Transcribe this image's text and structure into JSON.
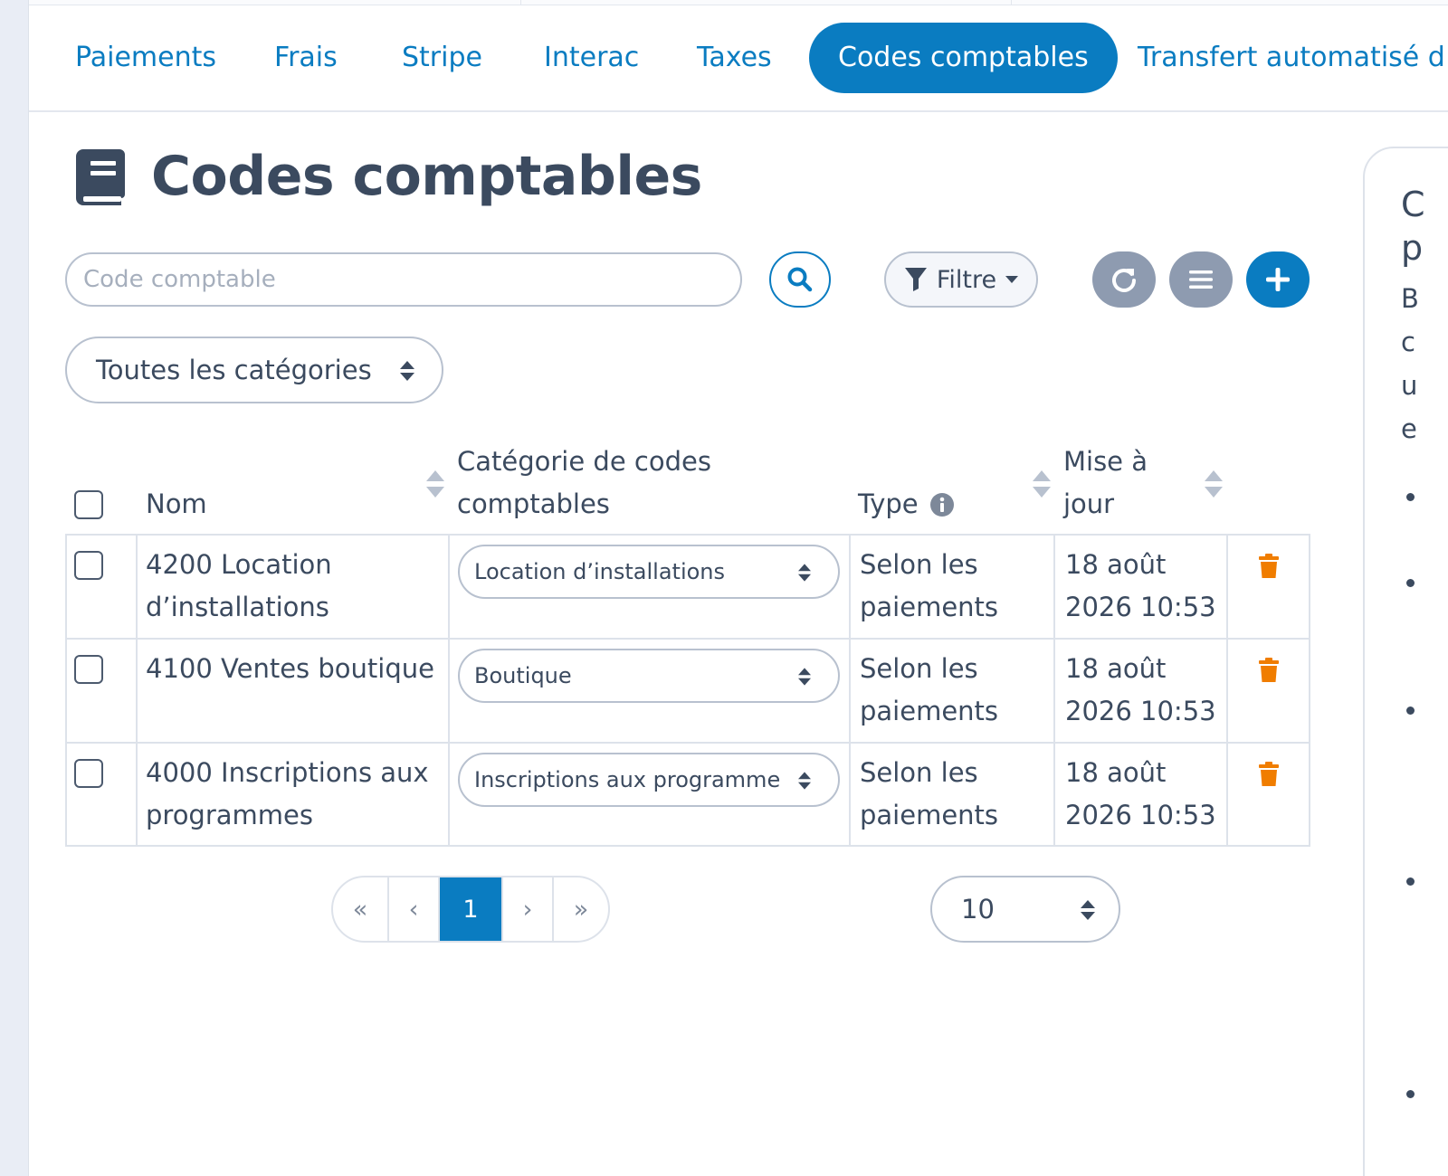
{
  "tabs": [
    {
      "label": "Paiements"
    },
    {
      "label": "Frais"
    },
    {
      "label": "Stripe"
    },
    {
      "label": "Interac"
    },
    {
      "label": "Taxes"
    },
    {
      "label": "Codes comptables"
    },
    {
      "label": "Transfert automatisé d"
    }
  ],
  "active_tab": "Codes comptables",
  "page": {
    "title": "Codes comptables",
    "title_icon": "book-icon"
  },
  "toolbar": {
    "search_placeholder": "Code comptable",
    "search_icon": "search-icon",
    "filter_label": "Filtre",
    "refresh_icon": "refresh-icon",
    "list_icon": "list-icon",
    "add_icon": "plus-icon"
  },
  "category_filter": {
    "selected": "Toutes les catégories"
  },
  "table": {
    "columns": {
      "name": "Nom",
      "category_line1": "Catégorie de codes",
      "category_line2": "comptables",
      "type": "Type",
      "updated_line1": "Mise à",
      "updated_line2": "jour"
    },
    "rows": [
      {
        "name_line1": "4200 Location",
        "name_line2": "d’installations",
        "category": "Location d’installations",
        "type_line1": "Selon les",
        "type_line2": "paiements",
        "updated_line1": "18 août",
        "updated_line2": "2026 10:53"
      },
      {
        "name_line1": "4100 Ventes boutique",
        "name_line2": "",
        "category": "Boutique",
        "type_line1": "Selon les",
        "type_line2": "paiements",
        "updated_line1": "18 août",
        "updated_line2": "2026 10:53"
      },
      {
        "name_line1": "4000 Inscriptions aux",
        "name_line2": "programmes",
        "category": "Inscriptions aux programme",
        "type_line1": "Selon les",
        "type_line2": "paiements",
        "updated_line1": "18 août",
        "updated_line2": "2026 10:53"
      }
    ]
  },
  "pagination": {
    "first": "«",
    "prev": "‹",
    "current": "1",
    "next": "›",
    "last": "»"
  },
  "per_page": {
    "selected": "10"
  },
  "side_panel": {
    "title_line1": "C",
    "title_line2": "p",
    "text_lines": [
      "B",
      "c",
      "u",
      "e"
    ]
  },
  "colors": {
    "primary": "#0a7cc1",
    "text": "#3b4a5f",
    "muted_button": "#8e9bb0",
    "danger": "#f07d00",
    "border": "#dde2ea"
  }
}
